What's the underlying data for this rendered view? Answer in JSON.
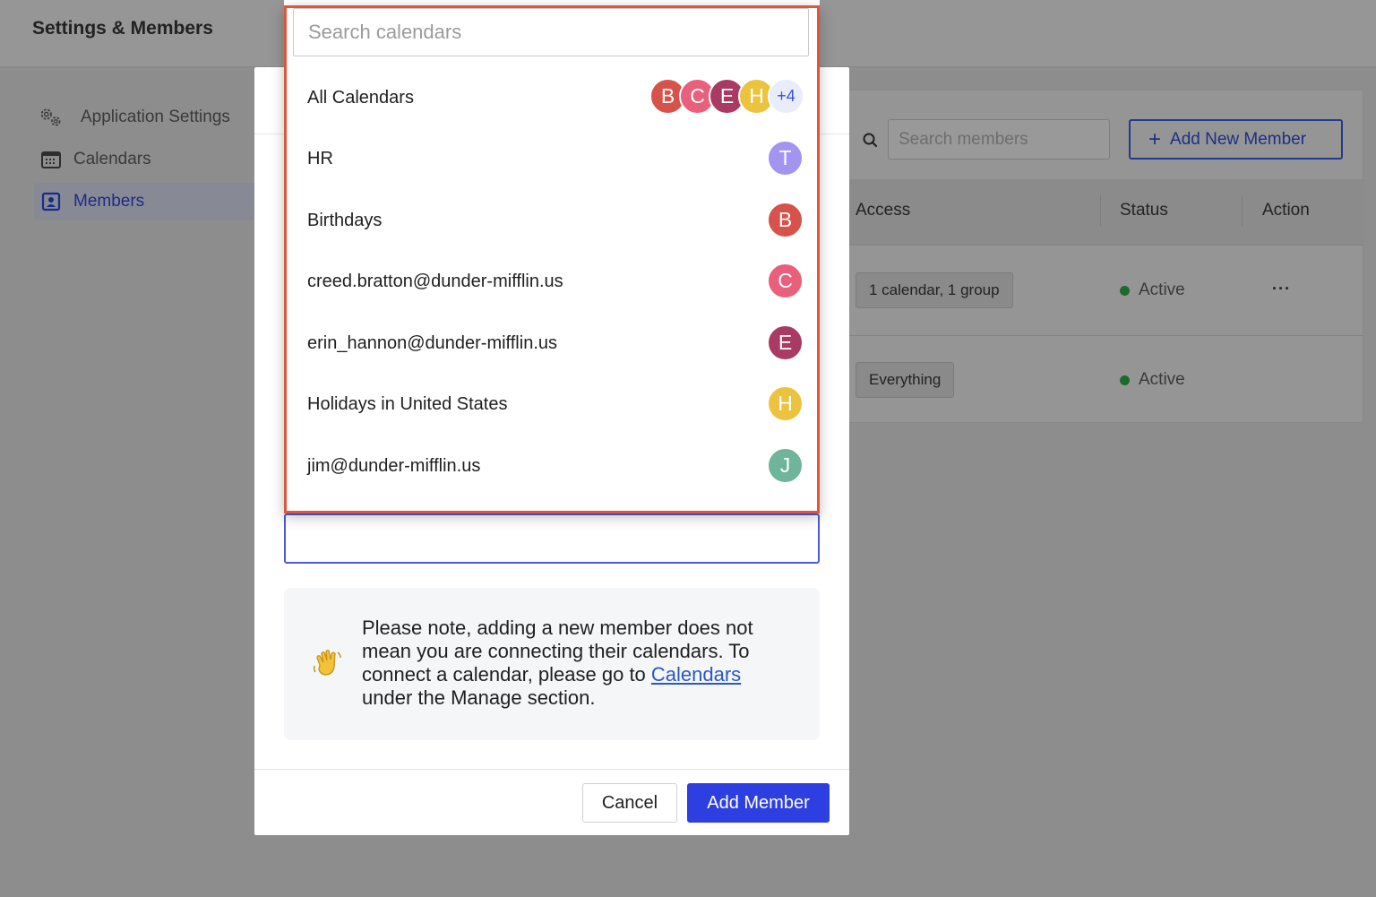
{
  "app": {
    "title": "Settings & Members"
  },
  "sidebar": {
    "items": [
      {
        "label": "Application Settings",
        "icon": "gears-icon",
        "active": false
      },
      {
        "label": "Calendars",
        "icon": "calendar-icon",
        "active": false
      },
      {
        "label": "Members",
        "icon": "person-card-icon",
        "active": true
      }
    ]
  },
  "members_panel": {
    "search_placeholder": "Search members",
    "add_new_label": "Add New Member",
    "columns": [
      "Access",
      "Status",
      "Action"
    ],
    "rows": [
      {
        "access": "1 calendar, 1 group",
        "status": "Active",
        "action": "···"
      },
      {
        "access": "Everything",
        "status": "Active"
      }
    ]
  },
  "dropdown": {
    "search_placeholder": "Search calendars",
    "items": [
      {
        "label": "All Calendars",
        "avatars": [
          "B",
          "C",
          "E",
          "H"
        ],
        "more": "+4"
      },
      {
        "label": "HR",
        "avatar": "T",
        "color": "#a394f0"
      },
      {
        "label": "Birthdays",
        "avatar": "B",
        "color": "#d6524a"
      },
      {
        "label": "creed.bratton@dunder-mifflin.us",
        "avatar": "C",
        "color": "#e8607c"
      },
      {
        "label": "erin_hannon@dunder-mifflin.us",
        "avatar": "E",
        "color": "#a83a63"
      },
      {
        "label": "Holidays in United States",
        "avatar": "H",
        "color": "#ecc33f"
      },
      {
        "label": "jim@dunder-mifflin.us",
        "avatar": "J",
        "color": "#6fb59b"
      }
    ]
  },
  "note": {
    "emoji": "waving-hand-icon",
    "text_before": "Please note, adding a new member does not mean you are connecting their calendars. To connect a calendar, please go to ",
    "link": "Calendars",
    "text_after": " under the Manage section."
  },
  "footer": {
    "cancel_label": "Cancel",
    "add_label": "Add Member"
  },
  "colors": {
    "primary": "#2d3fe0",
    "highlight_border": "#e0553c",
    "status_active": "#1d6b2c"
  }
}
